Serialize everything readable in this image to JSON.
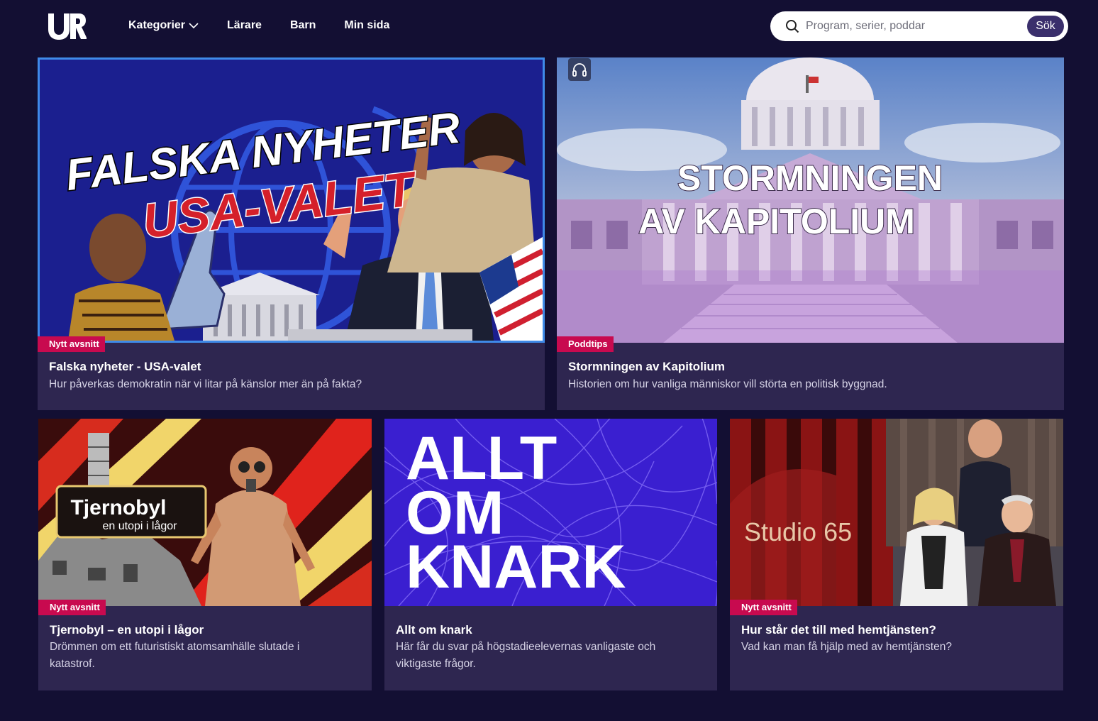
{
  "header": {
    "logo_alt": "UR",
    "nav": [
      {
        "label": "Kategorier",
        "has_dropdown": true
      },
      {
        "label": "Lärare"
      },
      {
        "label": "Barn"
      },
      {
        "label": "Min sida"
      }
    ],
    "search": {
      "placeholder": "Program, serier, poddar",
      "button_label": "Sök"
    }
  },
  "cards": [
    {
      "badge": "Nytt avsnitt",
      "title": "Falska nyheter - USA-valet",
      "description": "Hur påverkas demokratin när vi litar på känslor mer än på fakta?",
      "image_text": [
        "FALSKA NYHETER",
        "USA-VALET"
      ]
    },
    {
      "badge": "Poddtips",
      "title": "Stormningen av Kapitolium",
      "description": "Historien om hur vanliga människor vill störta en politisk byggnad.",
      "image_text": [
        "STORMNINGEN",
        "AV KAPITOLIUM"
      ],
      "icon": "headphones-icon"
    },
    {
      "badge": "Nytt avsnitt",
      "title": "Tjernobyl – en utopi i lågor",
      "description": "Drömmen om ett futuristiskt atomsamhälle slutade i katastrof.",
      "image_text": [
        "Tjernobyl",
        "en utopi i lågor"
      ]
    },
    {
      "title": "Allt om knark",
      "description": "Här får du svar på högstadieelevernas vanligaste och viktigaste frågor.",
      "image_text": [
        "ALLT",
        "OM",
        "KNARK"
      ]
    },
    {
      "badge": "Nytt avsnitt",
      "title": "Hur står det till med hemtjänsten?",
      "description": "Vad kan man få hjälp med av hemtjänsten?",
      "image_text": [
        "Studio 65"
      ]
    }
  ],
  "colors": {
    "background": "#130f33",
    "card": "#2e2650",
    "badge": "#c80a4f",
    "focus_border": "#3f8ae8"
  }
}
